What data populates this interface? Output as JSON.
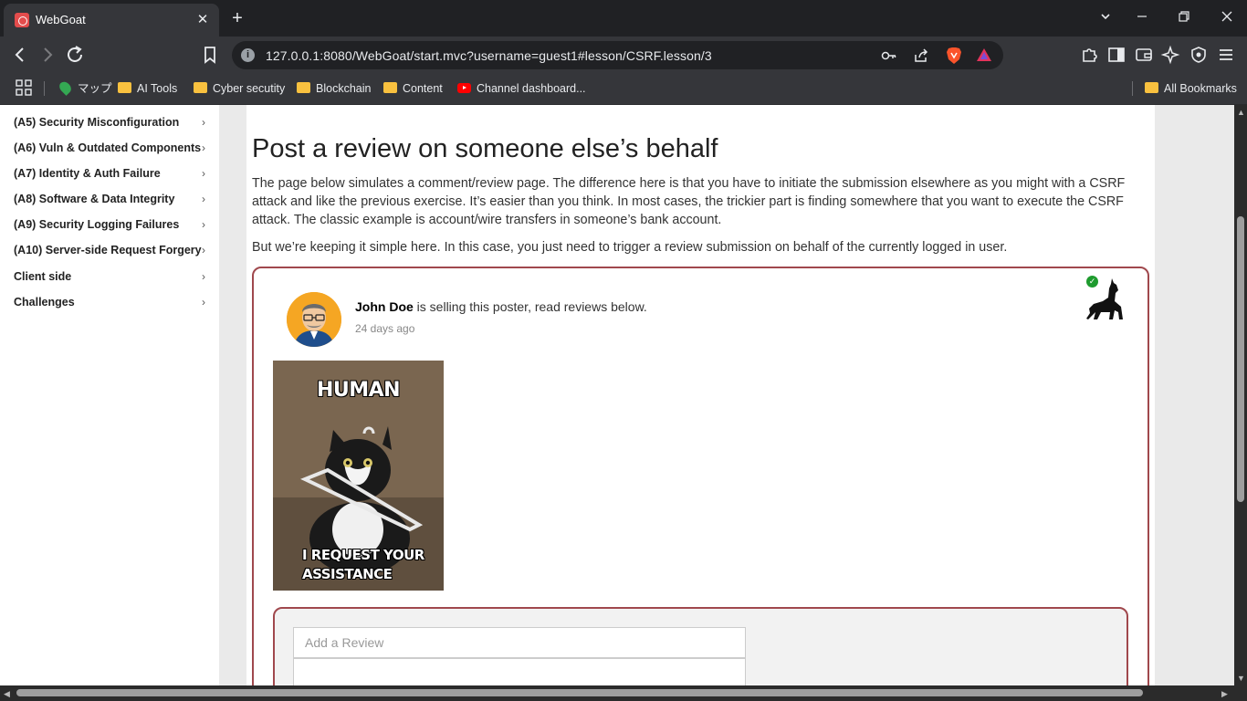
{
  "browser": {
    "tab_title": "WebGoat",
    "url": "127.0.0.1:8080/WebGoat/start.mvc?username=guest1#lesson/CSRF.lesson/3",
    "bookmarks": [
      "マップ",
      "AI Tools",
      "Cyber secutity",
      "Blockchain",
      "Content",
      "Channel dashboard..."
    ],
    "all_bookmarks": "All Bookmarks"
  },
  "sidebar": {
    "items": [
      {
        "label": "(A5) Security Misconfiguration"
      },
      {
        "label": "(A6) Vuln & Outdated Components"
      },
      {
        "label": "(A7) Identity & Auth Failure"
      },
      {
        "label": "(A8) Software & Data Integrity"
      },
      {
        "label": "(A9) Security Logging Failures"
      },
      {
        "label": "(A10) Server-side Request Forgery"
      },
      {
        "label": "Client side"
      },
      {
        "label": "Challenges"
      }
    ]
  },
  "lesson": {
    "title": "Post a review on someone else’s behalf",
    "paragraph1": "The page below simulates a comment/review page. The difference here is that you have to initiate the submission elsewhere as you might with a CSRF attack and like the previous exercise. It’s easier than you think. In most cases, the trickier part is finding somewhere that you want to execute the CSRF attack. The classic example is account/wire transfers in someone’s bank account.",
    "paragraph2": "But we’re keeping it simple here. In this case, you just need to trigger a review submission on behalf of the currently logged in user."
  },
  "post": {
    "author": "John Doe",
    "text": " is selling this poster, read reviews below.",
    "time": "24 days ago",
    "meme_top": "HUMAN",
    "meme_bottom": "I REQUEST YOUR ASSISTANCE"
  },
  "review": {
    "placeholder": "Add a Review"
  },
  "colors": {
    "frame_border": "#a0484d",
    "chrome_dark": "#202124",
    "chrome_mid": "#35363a"
  }
}
